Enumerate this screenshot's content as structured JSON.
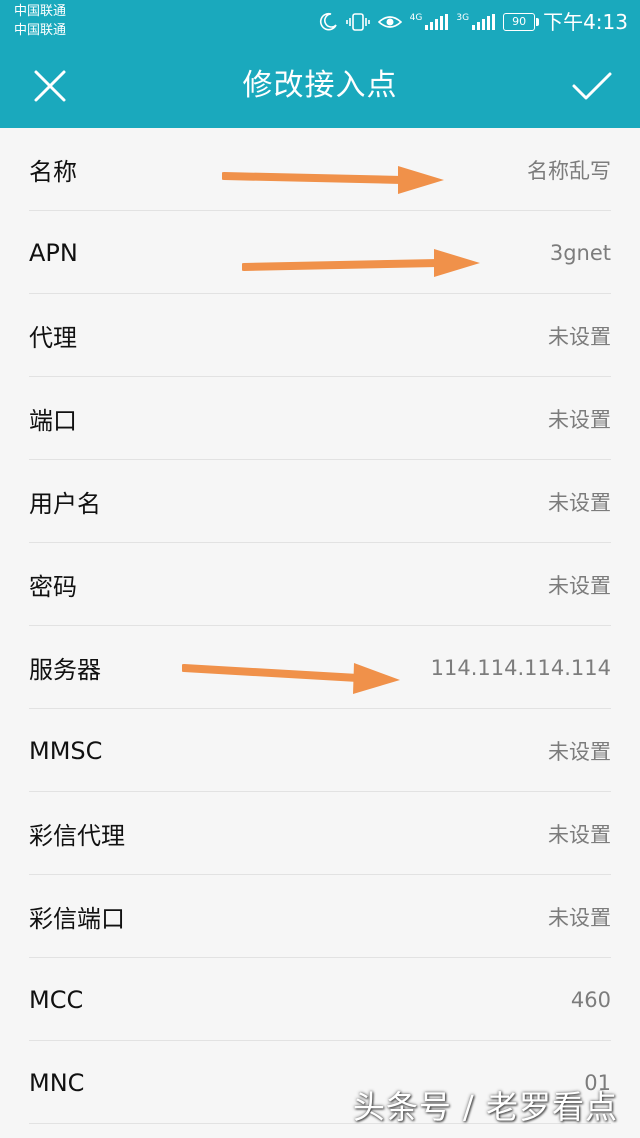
{
  "status_bar": {
    "carrier_1": "中国联通",
    "carrier_2": "中国联通",
    "net_1": "4G",
    "net_2": "3G",
    "battery": "90",
    "time": "下午4:13",
    "icons": [
      "moon-icon",
      "vibrate-icon",
      "eye-icon",
      "signal-icon",
      "battery-icon"
    ]
  },
  "toolbar": {
    "title": "修改接入点",
    "close_icon": "close-icon",
    "confirm_icon": "check-icon",
    "background": "#1aa9bd"
  },
  "fields": [
    {
      "label": "名称",
      "value": "名称乱写"
    },
    {
      "label": "APN",
      "value": "3gnet"
    },
    {
      "label": "代理",
      "value": "未设置"
    },
    {
      "label": "端口",
      "value": "未设置"
    },
    {
      "label": "用户名",
      "value": "未设置"
    },
    {
      "label": "密码",
      "value": "未设置"
    },
    {
      "label": "服务器",
      "value": "114.114.114.114"
    },
    {
      "label": "MMSC",
      "value": "未设置"
    },
    {
      "label": "彩信代理",
      "value": "未设置"
    },
    {
      "label": "彩信端口",
      "value": "未设置"
    },
    {
      "label": "MCC",
      "value": "460"
    },
    {
      "label": "MNC",
      "value": "01"
    }
  ],
  "annotation_color": "#f0914a",
  "watermark": "头条号 / 老罗看点"
}
